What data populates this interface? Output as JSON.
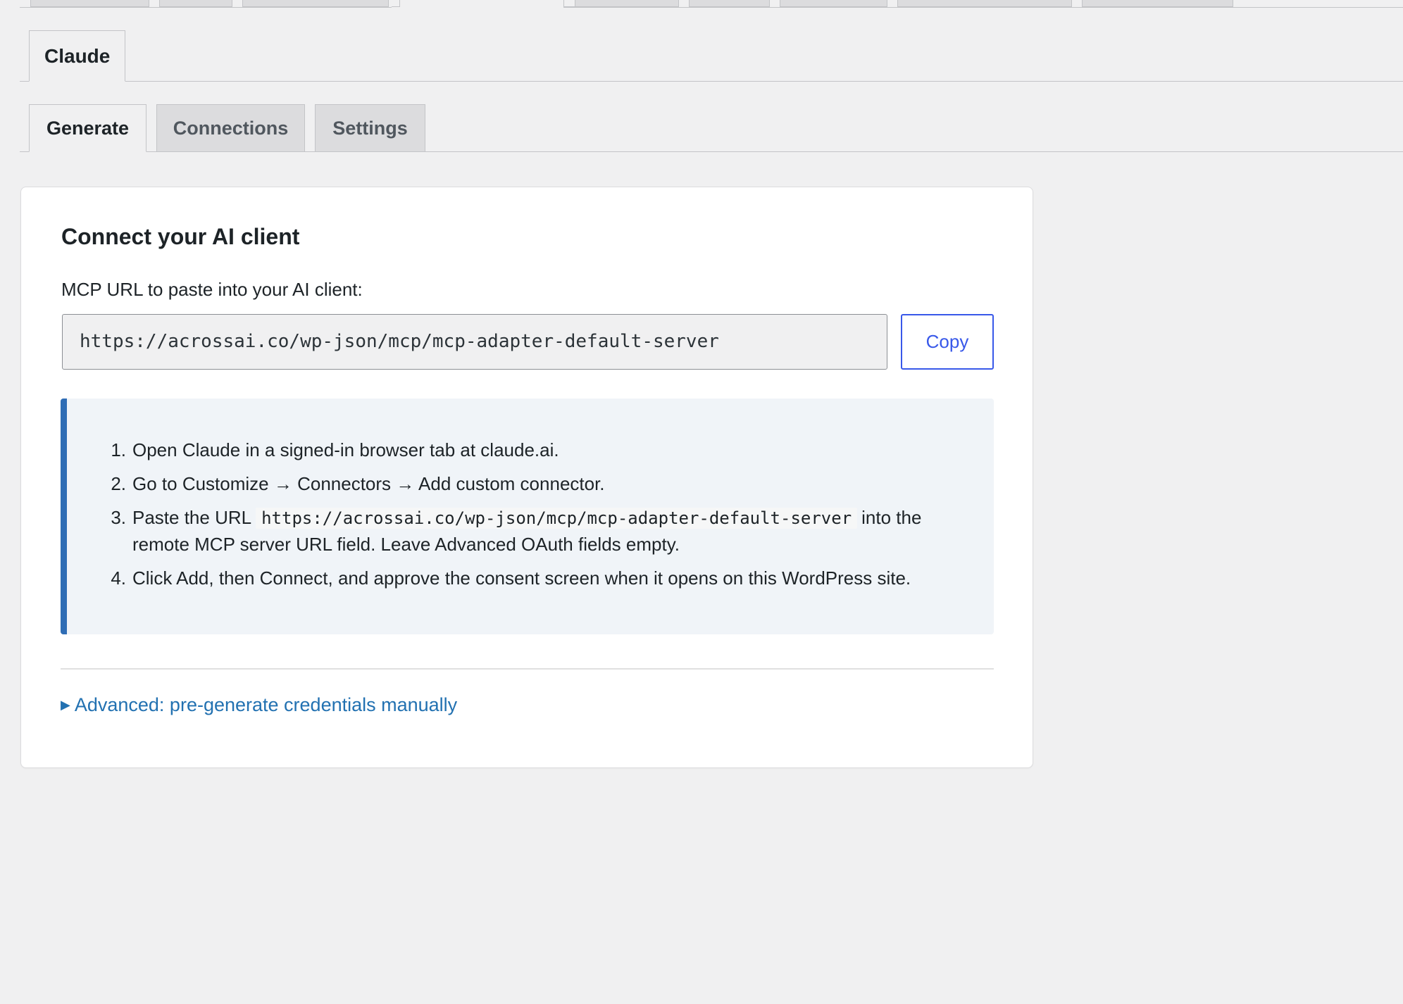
{
  "plugin_tabs": {
    "active_label": "Claude"
  },
  "sub_tabs": [
    {
      "label": "Generate",
      "active": true
    },
    {
      "label": "Connections",
      "active": false
    },
    {
      "label": "Settings",
      "active": false
    }
  ],
  "card": {
    "title": "Connect your AI client",
    "url_label": "MCP URL to paste into your AI client:",
    "url_value": "https://acrossai.co/wp-json/mcp/mcp-adapter-default-server",
    "copy_label": "Copy",
    "steps": [
      {
        "number": "1.",
        "text": "Open Claude in a signed-in browser tab at claude.ai."
      },
      {
        "number": "2.",
        "text": "Go to Customize → Connectors → Add custom connector."
      },
      {
        "number": "3.",
        "text_before": "Paste the URL",
        "code": "https://acrossai.co/wp-json/mcp/mcp-adapter-default-server",
        "text_after": "into the remote MCP server URL field. Leave Advanced OAuth fields empty."
      },
      {
        "number": "4.",
        "text": "Click Add, then Connect, and approve the consent screen when it opens on this WordPress site."
      }
    ],
    "advanced_toggle_label": "Advanced: pre-generate credentials manually",
    "advanced_toggle_icon": "triangle-right-icon"
  },
  "colors": {
    "page_background": "#f0f0f1",
    "card_background": "#ffffff",
    "notice_background": "#f0f4f8",
    "notice_border": "#2f6db5",
    "copy_button_accent": "#3858e9",
    "link": "#2271b1",
    "inactive_tab": "#dcdcde"
  }
}
